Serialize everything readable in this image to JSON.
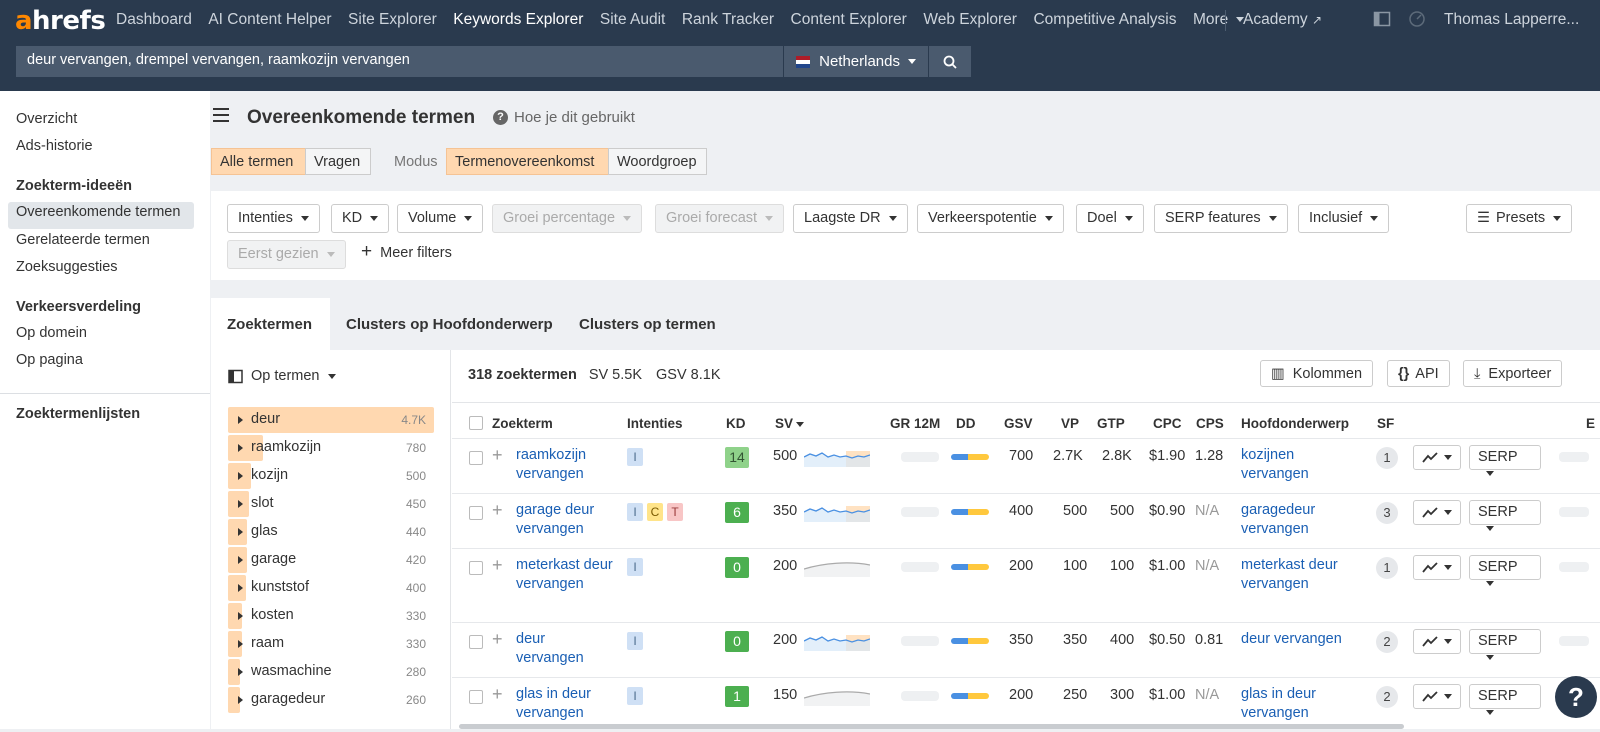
{
  "nav": {
    "logo_a": "a",
    "logo_rest": "hrefs",
    "items": [
      "Dashboard",
      "AI Content Helper",
      "Site Explorer",
      "Keywords Explorer",
      "Site Audit",
      "Rank Tracker",
      "Content Explorer",
      "Web Explorer",
      "Competitive Analysis",
      "More"
    ],
    "academy": "Academy",
    "user": "Thomas Lapperre..."
  },
  "search": {
    "value": "deur vervangen, drempel vervangen, raamkozijn vervangen",
    "country": "Netherlands"
  },
  "sidebar": {
    "overview": "Overzicht",
    "ads_history": "Ads-historie",
    "ideas_head": "Zoekterm-ideeën",
    "matching": "Overeenkomende termen",
    "related": "Gerelateerde termen",
    "suggestions": "Zoeksuggesties",
    "traffic_head": "Verkeersverdeling",
    "by_domain": "Op domein",
    "by_page": "Op pagina",
    "lists_head": "Zoektermenlijsten"
  },
  "page": {
    "title": "Overeenkomende termen",
    "help": "Hoe je dit gebruikt",
    "tab_all": "Alle termen",
    "tab_questions": "Vragen",
    "modus": "Modus",
    "tab_match": "Termenovereenkomst",
    "tab_phrase": "Woordgroep"
  },
  "filters": {
    "intents": "Intenties",
    "kd": "KD",
    "volume": "Volume",
    "growth_pct": "Groei percentage",
    "growth_fc": "Groei forecast",
    "lowest_dr": "Laagste DR",
    "traffic_pot": "Verkeerspotentie",
    "goal": "Doel",
    "serp": "SERP features",
    "inclusive": "Inclusief",
    "presets": "Presets",
    "first_seen": "Eerst gezien",
    "more": "Meer filters"
  },
  "result_tabs": {
    "terms": "Zoektermen",
    "clusters_topic": "Clusters op Hoofdonderwerp",
    "clusters_terms": "Clusters op termen"
  },
  "left_panel": {
    "by_terms": "Op termen",
    "keywords": [
      {
        "name": "deur",
        "count": "4.7K",
        "share": 1.0
      },
      {
        "name": "raamkozijn",
        "count": "780",
        "share": 0.17
      },
      {
        "name": "kozijn",
        "count": "500",
        "share": 0.11
      },
      {
        "name": "slot",
        "count": "450",
        "share": 0.1
      },
      {
        "name": "glas",
        "count": "440",
        "share": 0.09
      },
      {
        "name": "garage",
        "count": "420",
        "share": 0.09
      },
      {
        "name": "kunststof",
        "count": "400",
        "share": 0.085
      },
      {
        "name": "kosten",
        "count": "330",
        "share": 0.07
      },
      {
        "name": "raam",
        "count": "330",
        "share": 0.07
      },
      {
        "name": "wasmachine",
        "count": "280",
        "share": 0.06
      },
      {
        "name": "garagedeur",
        "count": "260",
        "share": 0.055
      }
    ]
  },
  "summary": {
    "count": "318 zoektermen",
    "sv": "SV 5.5K",
    "gsv": "GSV 8.1K",
    "columns": "Kolommen",
    "api": "API",
    "export": "Exporteer"
  },
  "table": {
    "headers": [
      "Zoekterm",
      "Intenties",
      "KD",
      "SV",
      "GR 12M",
      "DD",
      "GSV",
      "VP",
      "GTP",
      "CPC",
      "CPS",
      "Hoofdonderwerp",
      "SF",
      "E"
    ],
    "rows": [
      {
        "kw": "raamkozijn vervangen",
        "intents": [
          "I"
        ],
        "kd": "14",
        "kd_color": "#8fd28a",
        "sv": "500",
        "trend": "blue",
        "gsv": "700",
        "vp": "2.7K",
        "gtp": "2.8K",
        "cpc": "$1.90",
        "cps": "1.28",
        "topic": "kozijnen vervangen",
        "sf": "1",
        "serp": "SERP"
      },
      {
        "kw": "garage deur vervangen",
        "intents": [
          "I",
          "C",
          "T"
        ],
        "kd": "6",
        "kd_color": "#4caf50",
        "sv": "350",
        "trend": "blue",
        "gsv": "400",
        "vp": "500",
        "gtp": "500",
        "cpc": "$0.90",
        "cps": "N/A",
        "topic": "garagedeur vervangen",
        "sf": "3",
        "serp": "SERP"
      },
      {
        "kw": "meterkast deur vervangen",
        "intents": [
          "I"
        ],
        "kd": "0",
        "kd_color": "#4caf50",
        "sv": "200",
        "trend": "gray",
        "gsv": "200",
        "vp": "100",
        "gtp": "100",
        "cpc": "$1.00",
        "cps": "N/A",
        "topic": "meterkast deur vervangen",
        "sf": "1",
        "serp": "SERP"
      },
      {
        "kw": "deur vervangen",
        "intents": [
          "I"
        ],
        "kd": "0",
        "kd_color": "#4caf50",
        "sv": "200",
        "trend": "blue",
        "gsv": "350",
        "vp": "350",
        "gtp": "400",
        "cpc": "$0.50",
        "cps": "0.81",
        "topic": "deur vervangen",
        "sf": "2",
        "serp": "SERP"
      },
      {
        "kw": "glas in deur vervangen",
        "intents": [
          "I"
        ],
        "kd": "1",
        "kd_color": "#4caf50",
        "sv": "150",
        "trend": "gray",
        "gsv": "200",
        "vp": "250",
        "gtp": "300",
        "cpc": "$1.00",
        "cps": "N/A",
        "topic": "glas in deur vervangen",
        "sf": "2",
        "serp": "SERP"
      }
    ]
  },
  "help_bubble": "?"
}
